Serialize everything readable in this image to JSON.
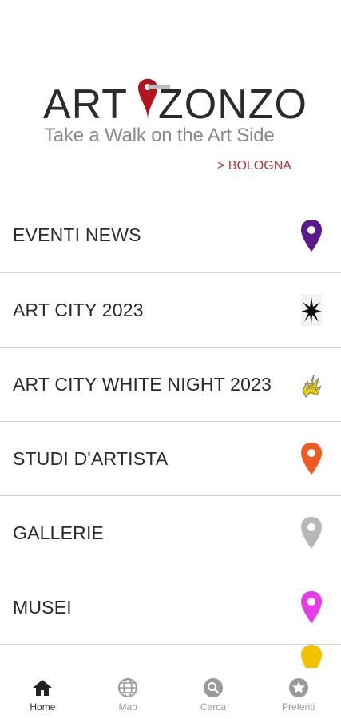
{
  "header": {
    "brand_left": "ART",
    "brand_right": "ZONZO",
    "tagline": "Take a Walk on the Art Side",
    "location": "> BOLOGNA"
  },
  "menu": {
    "items": [
      {
        "label": "EVENTI NEWS",
        "icon": "purple-map-pin-icon",
        "color": "#5b1a8b"
      },
      {
        "label": "ART CITY 2023",
        "icon": "black-star-burst-icon",
        "color": "#111111"
      },
      {
        "label": "ART CITY WHITE NIGHT 2023",
        "icon": "yellow-lightning-doodle-icon",
        "color": "#e6d000"
      },
      {
        "label": "STUDI D'ARTISTA",
        "icon": "orange-map-pin-icon",
        "color": "#f05a22"
      },
      {
        "label": "GALLERIE",
        "icon": "gray-map-pin-icon",
        "color": "#b8b8b8"
      },
      {
        "label": "MUSEI",
        "icon": "magenta-map-pin-icon",
        "color": "#e63ee6"
      }
    ]
  },
  "tabbar": {
    "tabs": [
      {
        "label": "Home",
        "icon": "home-icon",
        "active": true
      },
      {
        "label": "Map",
        "icon": "globe-icon",
        "active": false
      },
      {
        "label": "Cerca",
        "icon": "search-icon",
        "active": false
      },
      {
        "label": "Preferiti",
        "icon": "star-icon",
        "active": false
      }
    ]
  },
  "colors": {
    "brand_red": "#b3141e",
    "location_red": "#b3363c",
    "divider": "#d6d6d6"
  }
}
